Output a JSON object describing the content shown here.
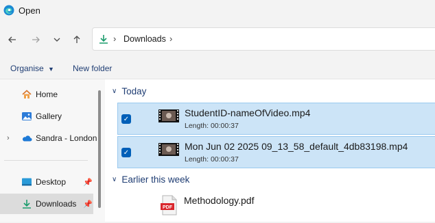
{
  "window": {
    "title": "Open"
  },
  "nav": {
    "back_icon": "arrow-left-icon",
    "forward_icon": "arrow-right-icon",
    "recent_icon": "chevron-down-icon",
    "up_icon": "arrow-up-icon",
    "breadcrumb": [
      "Downloads"
    ]
  },
  "commands": {
    "organise": "Organise",
    "new_folder": "New folder"
  },
  "sidebar": {
    "items": [
      {
        "label": "Home",
        "icon": "home-icon"
      },
      {
        "label": "Gallery",
        "icon": "gallery-icon"
      },
      {
        "label": "Sandra - London",
        "icon": "onedrive-icon"
      },
      {
        "label": "Desktop",
        "icon": "desktop-icon"
      },
      {
        "label": "Downloads",
        "icon": "download-icon"
      }
    ]
  },
  "groups": [
    {
      "name": "Today",
      "files": [
        {
          "name": "StudentID-nameOfVideo.mp4",
          "meta": "Length: 00:00:37",
          "icon": "video-thumbnail-icon",
          "selected": true
        },
        {
          "name": "Mon Jun 02 2025 09_13_58_default_4db83198.mp4",
          "meta": "Length: 00:00:37",
          "icon": "video-thumbnail-icon",
          "selected": true
        }
      ]
    },
    {
      "name": "Earlier this week",
      "files": [
        {
          "name": "Methodology.pdf",
          "icon": "pdf-icon"
        }
      ]
    }
  ],
  "colors": {
    "selection": "#cce4f7",
    "selection_border": "#99c9ef",
    "accent": "#005fb8",
    "link": "#1f3d73"
  }
}
